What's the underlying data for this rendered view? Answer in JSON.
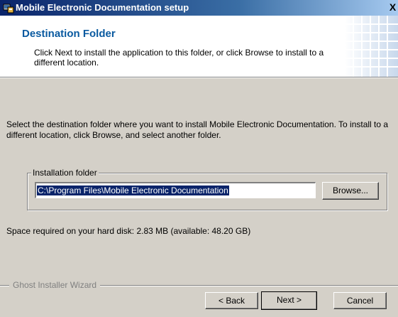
{
  "window": {
    "title": "Mobile Electronic Documentation setup",
    "close_glyph": "X",
    "icon": "installer-icon"
  },
  "header": {
    "title": "Destination Folder",
    "description": "Click Next to install the application to this folder, or click Browse to install to a different location."
  },
  "body": {
    "intro": "Select the destination folder where you want to install Mobile Electronic Documentation. To install to a different location, click Browse, and select another folder.",
    "group_label": "Installation folder",
    "folder_path": "C:\\Program Files\\Mobile Electronic Documentation",
    "browse_label": "Browse...",
    "space_required": "Space required on your hard disk: 2.83 MB  (available: 48.20 GB)"
  },
  "footer": {
    "brand": "Ghost Installer Wizard",
    "back_label": "< Back",
    "next_label": "Next >",
    "cancel_label": "Cancel"
  },
  "colors": {
    "title_start": "#0a246a",
    "title_end": "#a6caf0",
    "heading": "#0a5aa0",
    "selection": "#0a246a",
    "dialog_bg": "#d4d0c8"
  }
}
